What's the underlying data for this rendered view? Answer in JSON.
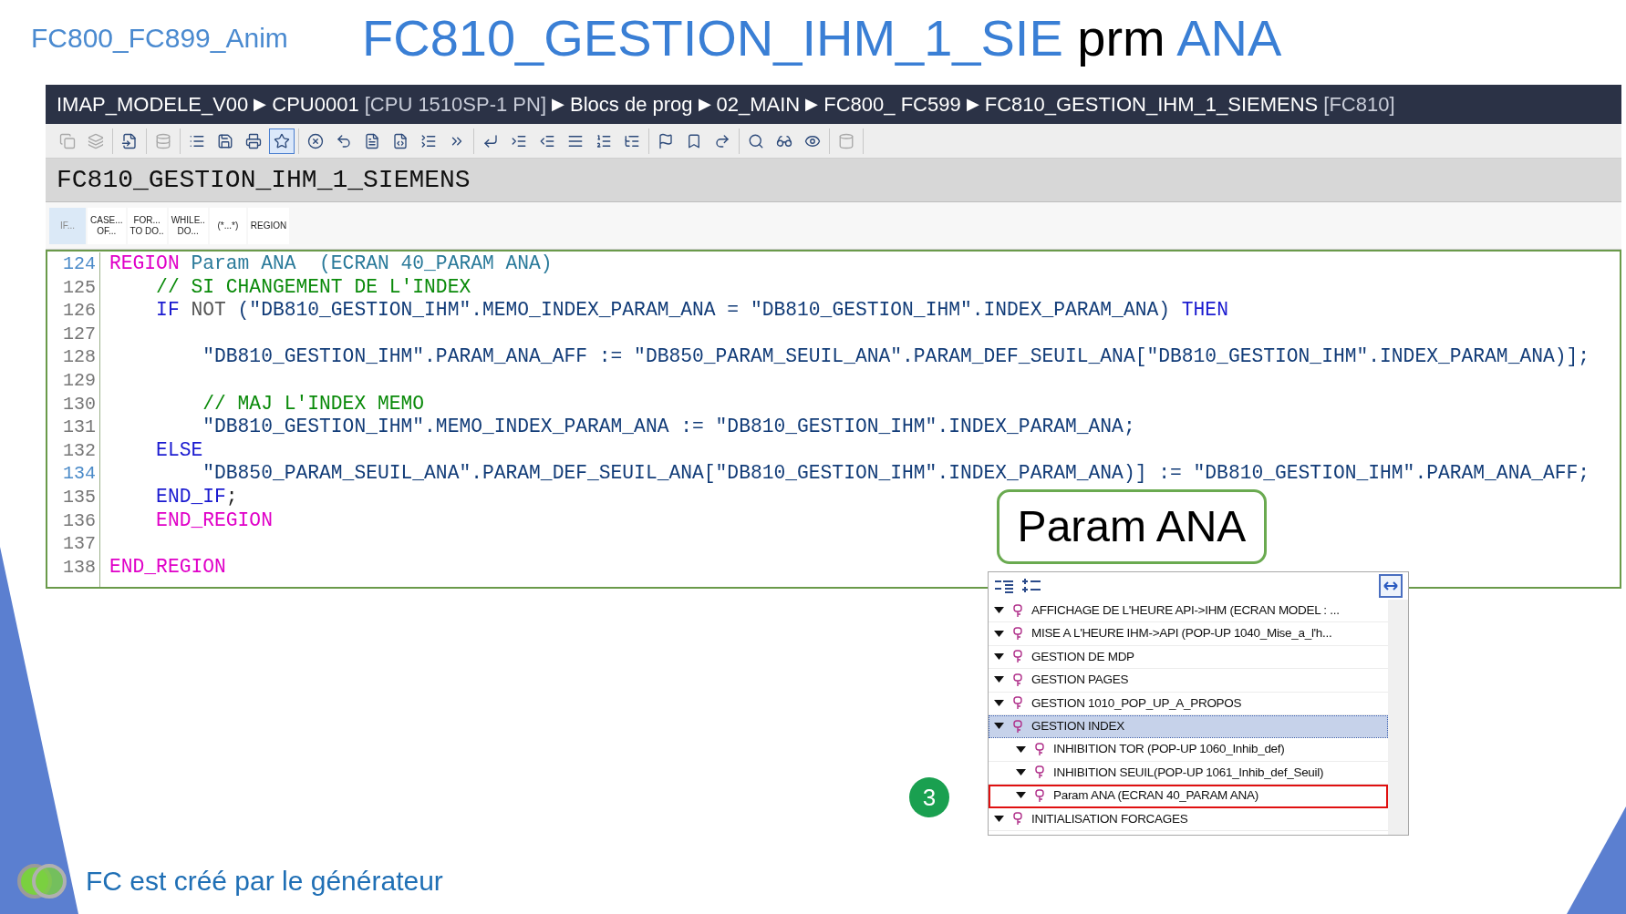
{
  "slide": {
    "section": "FC800_FC899_Anim",
    "title": [
      {
        "text": "FC810_GESTION_IHM_1_SIE",
        "kind": "accent"
      },
      {
        "text": " prm ",
        "kind": "plain"
      },
      {
        "text": "ANA",
        "kind": "accent"
      }
    ],
    "footer": "FC est créé par le générateur"
  },
  "breadcrumb": [
    {
      "text": "IMAP_MODELE_V00",
      "separator": "▶"
    },
    {
      "text": "CPU0001",
      "extra": "[CPU 1510SP-1 PN]",
      "separator": "▶"
    },
    {
      "text": "Blocs de prog",
      "separator": "▶"
    },
    {
      "text": "02_MAIN",
      "separator": "▶"
    },
    {
      "text": "FC800_ FC599",
      "separator": "▶"
    },
    {
      "text": "FC810_GESTION_IHM_1_SIEMENS",
      "extra": "[FC810]"
    }
  ],
  "toolbar": {
    "groups": [
      {
        "buttons": [
          {
            "disabled": true,
            "selected": false
          },
          {
            "disabled": true,
            "selected": false
          }
        ]
      },
      {
        "buttons": [
          {
            "disabled": false,
            "selected": false
          }
        ]
      },
      {
        "buttons": [
          {
            "disabled": true,
            "selected": false
          }
        ]
      },
      {
        "buttons": [
          {
            "disabled": false,
            "selected": false
          },
          {
            "disabled": false,
            "selected": false
          },
          {
            "disabled": false,
            "selected": false
          },
          {
            "disabled": false,
            "selected": true
          }
        ]
      },
      {
        "buttons": [
          {
            "disabled": false,
            "selected": false
          },
          {
            "disabled": false,
            "selected": false
          },
          {
            "disabled": false,
            "selected": false
          },
          {
            "disabled": false,
            "selected": false
          },
          {
            "disabled": false,
            "selected": false
          },
          {
            "disabled": false,
            "selected": false
          }
        ]
      },
      {
        "buttons": [
          {
            "disabled": false,
            "selected": false
          },
          {
            "disabled": false,
            "selected": false
          },
          {
            "disabled": false,
            "selected": false
          },
          {
            "disabled": false,
            "selected": false
          },
          {
            "disabled": false,
            "selected": false
          },
          {
            "disabled": false,
            "selected": false
          }
        ]
      },
      {
        "buttons": [
          {
            "disabled": false,
            "selected": false
          },
          {
            "disabled": false,
            "selected": false
          },
          {
            "disabled": false,
            "selected": false
          }
        ]
      },
      {
        "buttons": [
          {
            "disabled": false,
            "selected": false
          },
          {
            "disabled": false,
            "selected": false
          },
          {
            "disabled": false,
            "selected": false
          }
        ]
      },
      {
        "buttons": [
          {
            "disabled": true,
            "selected": false
          }
        ]
      }
    ]
  },
  "block_title": "FC810_GESTION_IHM_1_SIEMENS",
  "snippets": [
    {
      "label": "IF...",
      "selected": true
    },
    {
      "label": "CASE...\nOF...",
      "selected": false
    },
    {
      "label": "FOR...\nTO DO..",
      "selected": false
    },
    {
      "label": "WHILE..\nDO...",
      "selected": false
    },
    {
      "label": "(*...*)",
      "selected": false
    },
    {
      "label": "REGION",
      "selected": false
    }
  ],
  "code": [
    {
      "number": "124",
      "marked": true,
      "tokens": [
        {
          "text": "REGION",
          "kind": "region"
        },
        {
          "text": " Param ANA  (ECRAN 40_PARAM ANA)",
          "kind": "name"
        }
      ]
    },
    {
      "number": "125",
      "marked": false,
      "tokens": [
        {
          "text": "    // SI CHANGEMENT DE L'INDEX",
          "kind": "comment"
        }
      ]
    },
    {
      "number": "126",
      "marked": false,
      "tokens": [
        {
          "text": "    IF",
          "kind": "keyword"
        },
        {
          "text": " NOT ",
          "kind": "plain"
        },
        {
          "text": "(\"DB810_GESTION_IHM\".MEMO_INDEX_PARAM_ANA = \"DB810_GESTION_IHM\".INDEX_PARAM_ANA) ",
          "kind": "text"
        },
        {
          "text": "THEN",
          "kind": "keyword"
        }
      ]
    },
    {
      "number": "127",
      "marked": false
    },
    {
      "number": "128",
      "marked": false,
      "tokens": [
        {
          "text": "        \"DB810_GESTION_IHM\".PARAM_ANA_AFF := \"DB850_PARAM_SEUIL_ANA\".PARAM_DEF_SEUIL_ANA[\"DB810_GESTION_IHM\".INDEX_PARAM_ANA)];",
          "kind": "text"
        }
      ]
    },
    {
      "number": "129",
      "marked": false
    },
    {
      "number": "130",
      "marked": false,
      "tokens": [
        {
          "text": "        // MAJ L'INDEX MEMO",
          "kind": "comment"
        }
      ]
    },
    {
      "number": "131",
      "marked": false,
      "tokens": [
        {
          "text": "        \"DB810_GESTION_IHM\".MEMO_INDEX_PARAM_ANA := \"DB810_GESTION_IHM\".INDEX_PARAM_ANA;",
          "kind": "text"
        }
      ]
    },
    {
      "number": "132",
      "marked": false,
      "tokens": [
        {
          "text": "    ELSE",
          "kind": "keyword"
        }
      ]
    },
    {
      "number": "134",
      "marked": true,
      "tokens": [
        {
          "text": "        \"DB850_PARAM_SEUIL_ANA\".PARAM_DEF_SEUIL_ANA[\"DB810_GESTION_IHM\".INDEX_PARAM_ANA)] := \"DB810_GESTION_IHM\".PARAM_ANA_AFF;",
          "kind": "text"
        }
      ]
    },
    {
      "number": "135",
      "marked": false,
      "tokens": [
        {
          "text": "    END_IF",
          "kind": "keyword"
        },
        {
          "text": ";",
          "kind": "punct"
        }
      ]
    },
    {
      "number": "136",
      "marked": false,
      "tokens": [
        {
          "text": "    END_REGION",
          "kind": "region"
        }
      ]
    },
    {
      "number": "137",
      "marked": false
    },
    {
      "number": "138",
      "marked": false,
      "tokens": [
        {
          "text": "END_REGION",
          "kind": "region"
        }
      ]
    }
  ],
  "callout": "Param ANA",
  "step_badge": "3",
  "region_tree": [
    {
      "label": "AFFICHAGE DE L'HEURE API->IHM  (ECRAN MODEL : ...",
      "expanded": true,
      "selected": false,
      "outlined": false
    },
    {
      "label": "MISE A L'HEURE IHM->API (POP-UP 1040_Mise_a_l'h...",
      "expanded": true,
      "selected": false,
      "outlined": false
    },
    {
      "label": "GESTION DE MDP",
      "expanded": true,
      "selected": false,
      "outlined": false
    },
    {
      "label": "GESTION PAGES",
      "expanded": true,
      "selected": false,
      "outlined": false
    },
    {
      "label": "GESTION 1010_POP_UP_A_PROPOS",
      "expanded": true,
      "selected": false,
      "outlined": false
    },
    {
      "label": "GESTION INDEX",
      "expanded": true,
      "selected": true,
      "outlined": false,
      "children": [
        {
          "label": "INHIBITION TOR (POP-UP 1060_Inhib_def)",
          "expanded": true,
          "selected": false,
          "outlined": false
        },
        {
          "label": "INHIBITION SEUIL(POP-UP 1061_Inhib_def_Seuil)",
          "expanded": true,
          "selected": false,
          "outlined": false
        },
        {
          "label": "Param ANA  (ECRAN 40_PARAM ANA)",
          "expanded": true,
          "selected": false,
          "outlined": true
        }
      ]
    },
    {
      "label": "INITIALISATION FORCAGES",
      "expanded": true,
      "selected": false,
      "outlined": false
    }
  ]
}
